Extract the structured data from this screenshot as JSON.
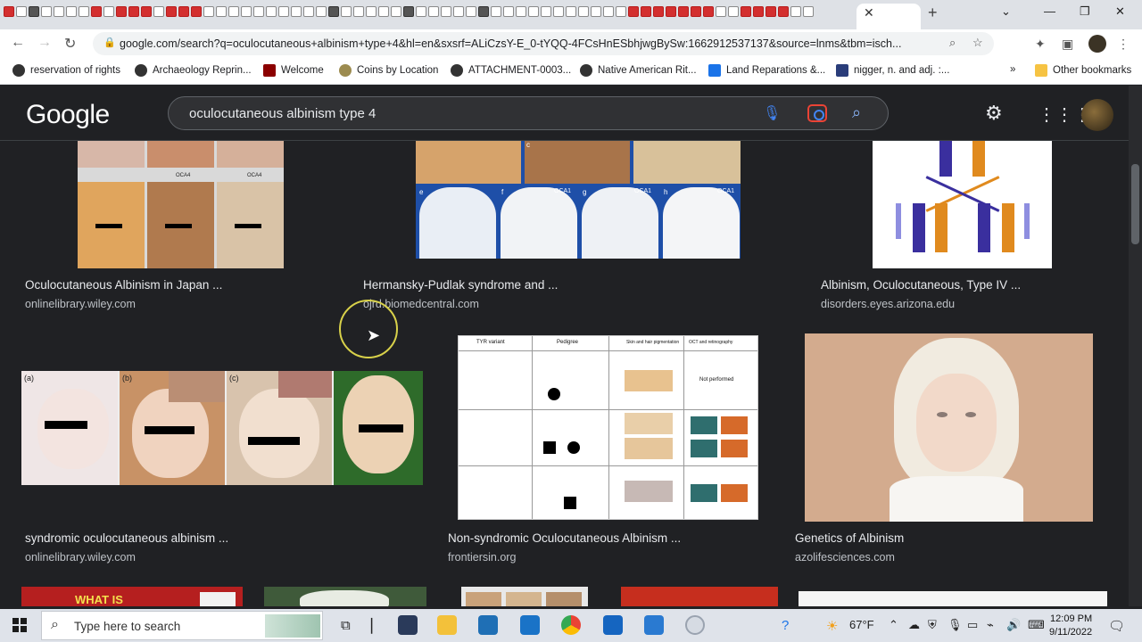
{
  "browser": {
    "url": "google.com/search?q=oculocutaneous+albinism+type+4&hl=en&sxsrf=ALiCzsY-E_0-tYQQ-4FCsHnESbhjwgBySw:1662912537137&source=lnms&tbm=isch...",
    "bookmarks": [
      {
        "label": "reservation of rights",
        "icon": "globe-icon"
      },
      {
        "label": "Archaeology Reprin...",
        "icon": "globe-icon"
      },
      {
        "label": "Welcome",
        "icon": "site-icon"
      },
      {
        "label": "Coins by Location",
        "icon": "coin-icon"
      },
      {
        "label": "ATTACHMENT-0003...",
        "icon": "globe-icon"
      },
      {
        "label": "Native American Rit...",
        "icon": "globe-icon"
      },
      {
        "label": "Land Reparations &...",
        "icon": "site-icon"
      },
      {
        "label": "nigger, n. and adj. :...",
        "icon": "site-icon"
      }
    ],
    "other_bookmarks": "Other bookmarks",
    "more_bookmarks": "»"
  },
  "google": {
    "logo": "Google",
    "query": "oculocutaneous albinism type 4"
  },
  "results": [
    {
      "title": "Oculocutaneous Albinism in Japan ...",
      "source": "onlinelibrary.wiley.com"
    },
    {
      "title": "Hermansky-Pudlak syndrome and ...",
      "source": "ojrd.biomedcentral.com"
    },
    {
      "title": "Albinism, Oculocutaneous, Type IV ...",
      "source": "disorders.eyes.arizona.edu"
    },
    {
      "title": "syndromic oculocutaneous albinism ...",
      "source": "onlinelibrary.wiley.com"
    },
    {
      "title": "Non-syndromic Oculocutaneous Albinism ...",
      "source": "frontiersin.org"
    },
    {
      "title": "Genetics of Albinism",
      "source": "azolifesciences.com"
    }
  ],
  "image_text": {
    "bottom_banner": "WHAT IS",
    "table_headers": [
      "TYR variant",
      "Pedigree",
      "Skin and hair pigmentation",
      "OCT and retinography"
    ],
    "table_note": "Not performed",
    "japan_labels": [
      "OCA4",
      "OCA4",
      "OCA4"
    ],
    "hps_labels": [
      "c",
      "e",
      "f",
      "g",
      "h",
      "OCA1",
      "OCA1",
      "OCA1"
    ],
    "panel_labels": [
      "(a)",
      "(b)",
      "(c)"
    ]
  },
  "taskbar": {
    "search_placeholder": "Type here to search",
    "weather": "67°F",
    "time": "12:09 PM",
    "date": "9/11/2022"
  }
}
